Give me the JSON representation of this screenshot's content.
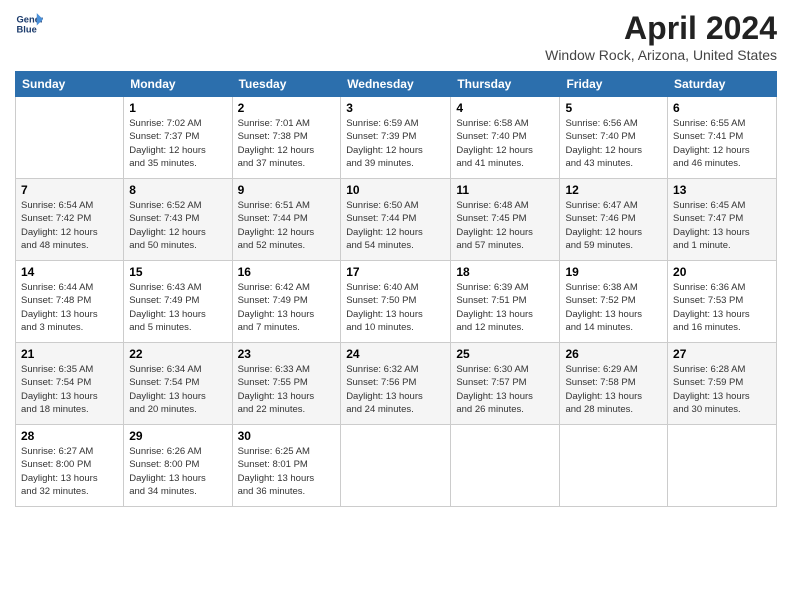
{
  "brand": {
    "name_line1": "General",
    "name_line2": "Blue"
  },
  "header": {
    "title": "April 2024",
    "subtitle": "Window Rock, Arizona, United States"
  },
  "days_of_week": [
    "Sunday",
    "Monday",
    "Tuesday",
    "Wednesday",
    "Thursday",
    "Friday",
    "Saturday"
  ],
  "weeks": [
    [
      {
        "day": "",
        "info": ""
      },
      {
        "day": "1",
        "info": "Sunrise: 7:02 AM\nSunset: 7:37 PM\nDaylight: 12 hours\nand 35 minutes."
      },
      {
        "day": "2",
        "info": "Sunrise: 7:01 AM\nSunset: 7:38 PM\nDaylight: 12 hours\nand 37 minutes."
      },
      {
        "day": "3",
        "info": "Sunrise: 6:59 AM\nSunset: 7:39 PM\nDaylight: 12 hours\nand 39 minutes."
      },
      {
        "day": "4",
        "info": "Sunrise: 6:58 AM\nSunset: 7:40 PM\nDaylight: 12 hours\nand 41 minutes."
      },
      {
        "day": "5",
        "info": "Sunrise: 6:56 AM\nSunset: 7:40 PM\nDaylight: 12 hours\nand 43 minutes."
      },
      {
        "day": "6",
        "info": "Sunrise: 6:55 AM\nSunset: 7:41 PM\nDaylight: 12 hours\nand 46 minutes."
      }
    ],
    [
      {
        "day": "7",
        "info": "Sunrise: 6:54 AM\nSunset: 7:42 PM\nDaylight: 12 hours\nand 48 minutes."
      },
      {
        "day": "8",
        "info": "Sunrise: 6:52 AM\nSunset: 7:43 PM\nDaylight: 12 hours\nand 50 minutes."
      },
      {
        "day": "9",
        "info": "Sunrise: 6:51 AM\nSunset: 7:44 PM\nDaylight: 12 hours\nand 52 minutes."
      },
      {
        "day": "10",
        "info": "Sunrise: 6:50 AM\nSunset: 7:44 PM\nDaylight: 12 hours\nand 54 minutes."
      },
      {
        "day": "11",
        "info": "Sunrise: 6:48 AM\nSunset: 7:45 PM\nDaylight: 12 hours\nand 57 minutes."
      },
      {
        "day": "12",
        "info": "Sunrise: 6:47 AM\nSunset: 7:46 PM\nDaylight: 12 hours\nand 59 minutes."
      },
      {
        "day": "13",
        "info": "Sunrise: 6:45 AM\nSunset: 7:47 PM\nDaylight: 13 hours\nand 1 minute."
      }
    ],
    [
      {
        "day": "14",
        "info": "Sunrise: 6:44 AM\nSunset: 7:48 PM\nDaylight: 13 hours\nand 3 minutes."
      },
      {
        "day": "15",
        "info": "Sunrise: 6:43 AM\nSunset: 7:49 PM\nDaylight: 13 hours\nand 5 minutes."
      },
      {
        "day": "16",
        "info": "Sunrise: 6:42 AM\nSunset: 7:49 PM\nDaylight: 13 hours\nand 7 minutes."
      },
      {
        "day": "17",
        "info": "Sunrise: 6:40 AM\nSunset: 7:50 PM\nDaylight: 13 hours\nand 10 minutes."
      },
      {
        "day": "18",
        "info": "Sunrise: 6:39 AM\nSunset: 7:51 PM\nDaylight: 13 hours\nand 12 minutes."
      },
      {
        "day": "19",
        "info": "Sunrise: 6:38 AM\nSunset: 7:52 PM\nDaylight: 13 hours\nand 14 minutes."
      },
      {
        "day": "20",
        "info": "Sunrise: 6:36 AM\nSunset: 7:53 PM\nDaylight: 13 hours\nand 16 minutes."
      }
    ],
    [
      {
        "day": "21",
        "info": "Sunrise: 6:35 AM\nSunset: 7:54 PM\nDaylight: 13 hours\nand 18 minutes."
      },
      {
        "day": "22",
        "info": "Sunrise: 6:34 AM\nSunset: 7:54 PM\nDaylight: 13 hours\nand 20 minutes."
      },
      {
        "day": "23",
        "info": "Sunrise: 6:33 AM\nSunset: 7:55 PM\nDaylight: 13 hours\nand 22 minutes."
      },
      {
        "day": "24",
        "info": "Sunrise: 6:32 AM\nSunset: 7:56 PM\nDaylight: 13 hours\nand 24 minutes."
      },
      {
        "day": "25",
        "info": "Sunrise: 6:30 AM\nSunset: 7:57 PM\nDaylight: 13 hours\nand 26 minutes."
      },
      {
        "day": "26",
        "info": "Sunrise: 6:29 AM\nSunset: 7:58 PM\nDaylight: 13 hours\nand 28 minutes."
      },
      {
        "day": "27",
        "info": "Sunrise: 6:28 AM\nSunset: 7:59 PM\nDaylight: 13 hours\nand 30 minutes."
      }
    ],
    [
      {
        "day": "28",
        "info": "Sunrise: 6:27 AM\nSunset: 8:00 PM\nDaylight: 13 hours\nand 32 minutes."
      },
      {
        "day": "29",
        "info": "Sunrise: 6:26 AM\nSunset: 8:00 PM\nDaylight: 13 hours\nand 34 minutes."
      },
      {
        "day": "30",
        "info": "Sunrise: 6:25 AM\nSunset: 8:01 PM\nDaylight: 13 hours\nand 36 minutes."
      },
      {
        "day": "",
        "info": ""
      },
      {
        "day": "",
        "info": ""
      },
      {
        "day": "",
        "info": ""
      },
      {
        "day": "",
        "info": ""
      }
    ]
  ]
}
